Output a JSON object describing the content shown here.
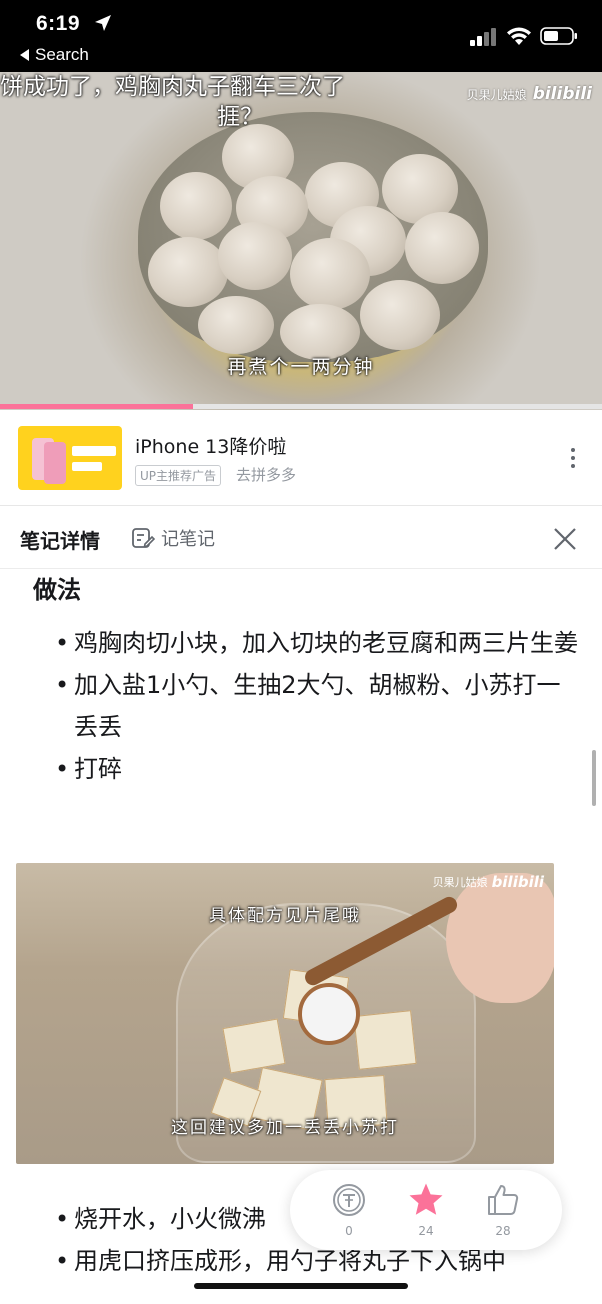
{
  "status_bar": {
    "time": "6:19",
    "back_label": "Search"
  },
  "video": {
    "title_line1": "饼成功了，鸡胸肉丸子翻车三次了",
    "title_line2": "捱？",
    "watermark_author": "贝果儿姑娘",
    "watermark_brand": "bilibili",
    "subtitle": "再煮个一两分钟",
    "progress_fraction": 0.32
  },
  "ad": {
    "title": "iPhone 13降价啦",
    "badge": "UP主推荐广告",
    "subtitle": "去拼多多"
  },
  "note_header": {
    "title": "笔记详情",
    "write_label": "记笔记"
  },
  "note": {
    "heading": "做法",
    "steps": [
      "鸡胸肉切小块，加入切块的老豆腐和两三片生姜",
      "加入盐1小勺、生抽2大勺、胡椒粉、小苏打一丢丢",
      "打碎"
    ],
    "image": {
      "caption_top": "具体配方见片尾哦",
      "caption_bottom": "这回建议多加一丢丢小苏打",
      "watermark_author": "贝果儿姑娘",
      "watermark_brand": "bilibili"
    },
    "steps_after": [
      "烧开水，小火微沸",
      "用虎口挤压成形，用勺子将丸子下入锅中"
    ]
  },
  "actions": {
    "coin_count": "0",
    "favorite_count": "24",
    "like_count": "28"
  },
  "colors": {
    "brand_pink": "#fb7299",
    "text_primary": "#18191c",
    "text_secondary": "#9499a0"
  }
}
